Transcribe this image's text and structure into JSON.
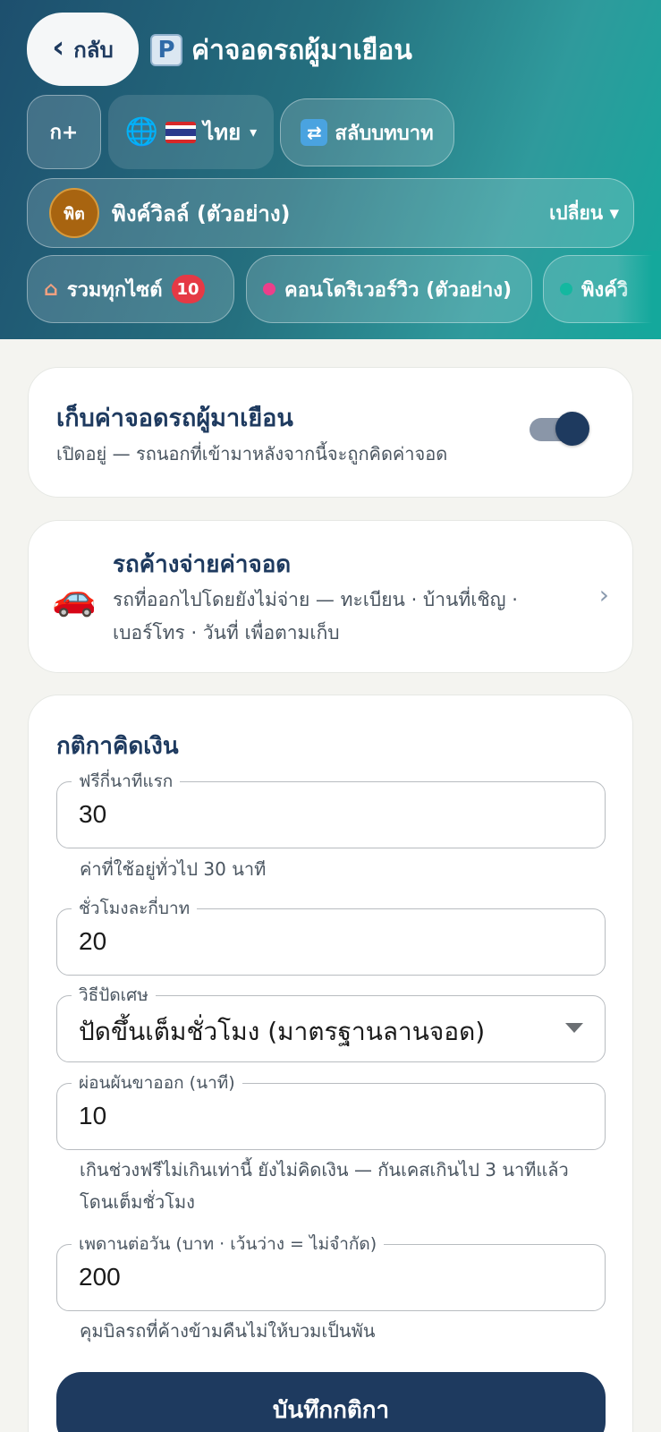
{
  "header": {
    "back_label": "กลับ",
    "title": "ค่าจอดรถผู้มาเยือน",
    "font_size_label": "ก+",
    "language_label": "ไทย",
    "switch_role_label": "สลับบทบาท",
    "tenant": {
      "avatar_text": "พิต",
      "name": "พิงค์วิลล์ (ตัวอย่าง)",
      "change_label": "เปลี่ยน"
    },
    "site_chips": [
      {
        "label": "รวมทุกไซต์",
        "badge": "10",
        "dot_color": ""
      },
      {
        "label": "คอนโดริเวอร์วิว (ตัวอย่าง)",
        "badge": "",
        "dot_color": "#ec3f8a"
      },
      {
        "label": "พิงค์วิ",
        "badge": "",
        "dot_color": "#14b8a0"
      }
    ]
  },
  "toggle_card": {
    "title": "เก็บค่าจอดรถผู้มาเยือน",
    "subtitle": "เปิดอยู่ — รถนอกที่เข้ามาหลังจากนี้จะถูกคิดค่าจอด",
    "enabled": true
  },
  "unpaid_card": {
    "title": "รถค้างจ่ายค่าจอด",
    "description": "รถที่ออกไปโดยยังไม่จ่าย — ทะเบียน · บ้านที่เชิญ · เบอร์โทร · วันที่ เพื่อตามเก็บ"
  },
  "rules_card": {
    "title": "กติกาคิดเงิน",
    "free_minutes": {
      "label": "ฟรีกี่นาทีแรก",
      "value": "30",
      "helper": "ค่าที่ใช้อยู่ทั่วไป 30 นาที"
    },
    "hourly_rate": {
      "label": "ชั่วโมงละกี่บาท",
      "value": "20"
    },
    "rounding": {
      "label": "วิธีปัดเศษ",
      "value": "ปัดขึ้นเต็มชั่วโมง (มาตรฐานลานจอด)"
    },
    "grace_minutes": {
      "label": "ผ่อนผันขาออก (นาที)",
      "value": "10",
      "helper": "เกินช่วงฟรีไม่เกินเท่านี้ ยังไม่คิดเงิน — กันเคสเกินไป 3 นาทีแล้วโดนเต็มชั่วโมง"
    },
    "daily_cap": {
      "label": "เพดานต่อวัน (บาท · เว้นว่าง = ไม่จำกัด)",
      "value": "200",
      "helper": "คุมบิลรถที่ค้างข้ามคืนไม่ให้บวมเป็นพัน"
    },
    "save_label": "บันทึกกติกา"
  }
}
